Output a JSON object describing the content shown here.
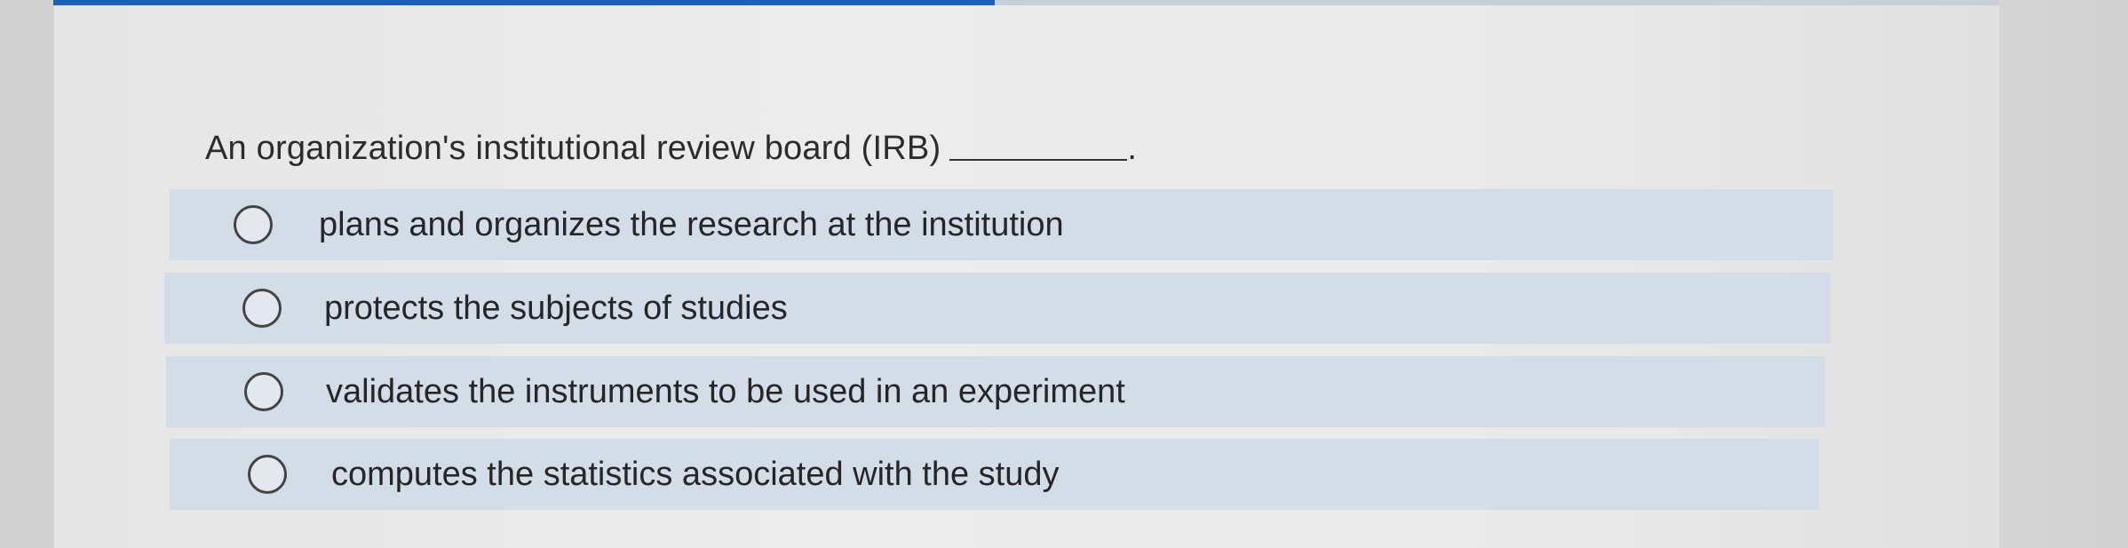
{
  "question": {
    "text": "An organization's institutional review board (IRB)",
    "terminator": "."
  },
  "options": [
    {
      "label": "plans and organizes the research at the institution",
      "selected": false
    },
    {
      "label": "protects the subjects of studies",
      "selected": false
    },
    {
      "label": "validates the instruments to be used in an experiment",
      "selected": false
    },
    {
      "label": "computes the statistics associated with the study",
      "selected": false
    }
  ],
  "colors": {
    "accent_bar": "#1e5fb8",
    "option_bg": "#d2dde8"
  }
}
